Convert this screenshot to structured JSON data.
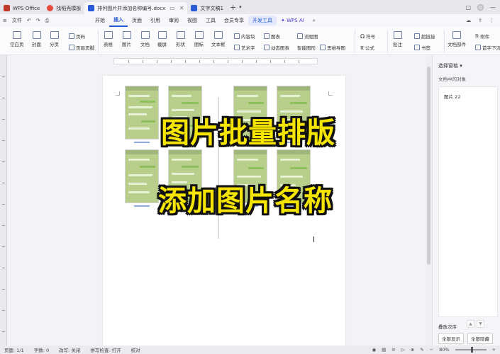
{
  "tabs": [
    {
      "label": "WPS Office",
      "color": "#c0392b"
    },
    {
      "label": "找稻壳模板",
      "color": "#e74c3c"
    },
    {
      "label": "排列图片并添加名称编号.docx",
      "color": "#2a5bd7"
    },
    {
      "label": "文字文稿1",
      "color": "#2a5bd7"
    }
  ],
  "menubar": {
    "file_label": "文件",
    "items": [
      "开始",
      "插入",
      "页面",
      "引用",
      "审阅",
      "视图",
      "工具",
      "会员专享"
    ],
    "active": "插入",
    "special": "开发工具",
    "ai_label": "WPS AI"
  },
  "ribbon": {
    "blank_page": "空白页",
    "cover": "封面",
    "section_break": "分页",
    "page": "页码",
    "header_footer": "页眉页脚",
    "table": "表格",
    "image": "图片",
    "text_doc": "文档",
    "screenshot": "截屏",
    "shape": "形状",
    "icon": "图标",
    "textbox": "文本框",
    "content_ctrl": "内容块",
    "art_text": "艺术字",
    "chart": "图表",
    "dynamic_chart": "动态图表",
    "flowchart": "流程图",
    "smart_shape": "智能图形",
    "mindmap": "思维导图",
    "symbol": "符号",
    "formula": "公式",
    "comment": "批注",
    "hyperlink": "超链接",
    "bookmark": "书签",
    "attachment": "附件",
    "doc_part": "文档部件",
    "first_drop": "首字下沉"
  },
  "document": {
    "overlay_line1": "图片批量排版",
    "overlay_line2": "添加图片名称"
  },
  "pane": {
    "title": "选择窗格",
    "subtitle": "文档中的对象",
    "item": "图片 22",
    "order_label": "叠放次序",
    "show_all": "全部显示",
    "hide_all": "全部隐藏"
  },
  "status": {
    "page": "页面: 1/1",
    "words": "字数: 0",
    "revise": "改写: 关闭",
    "spell": "拼写检查: 打开",
    "proof": "校对",
    "zoom": "80%"
  }
}
